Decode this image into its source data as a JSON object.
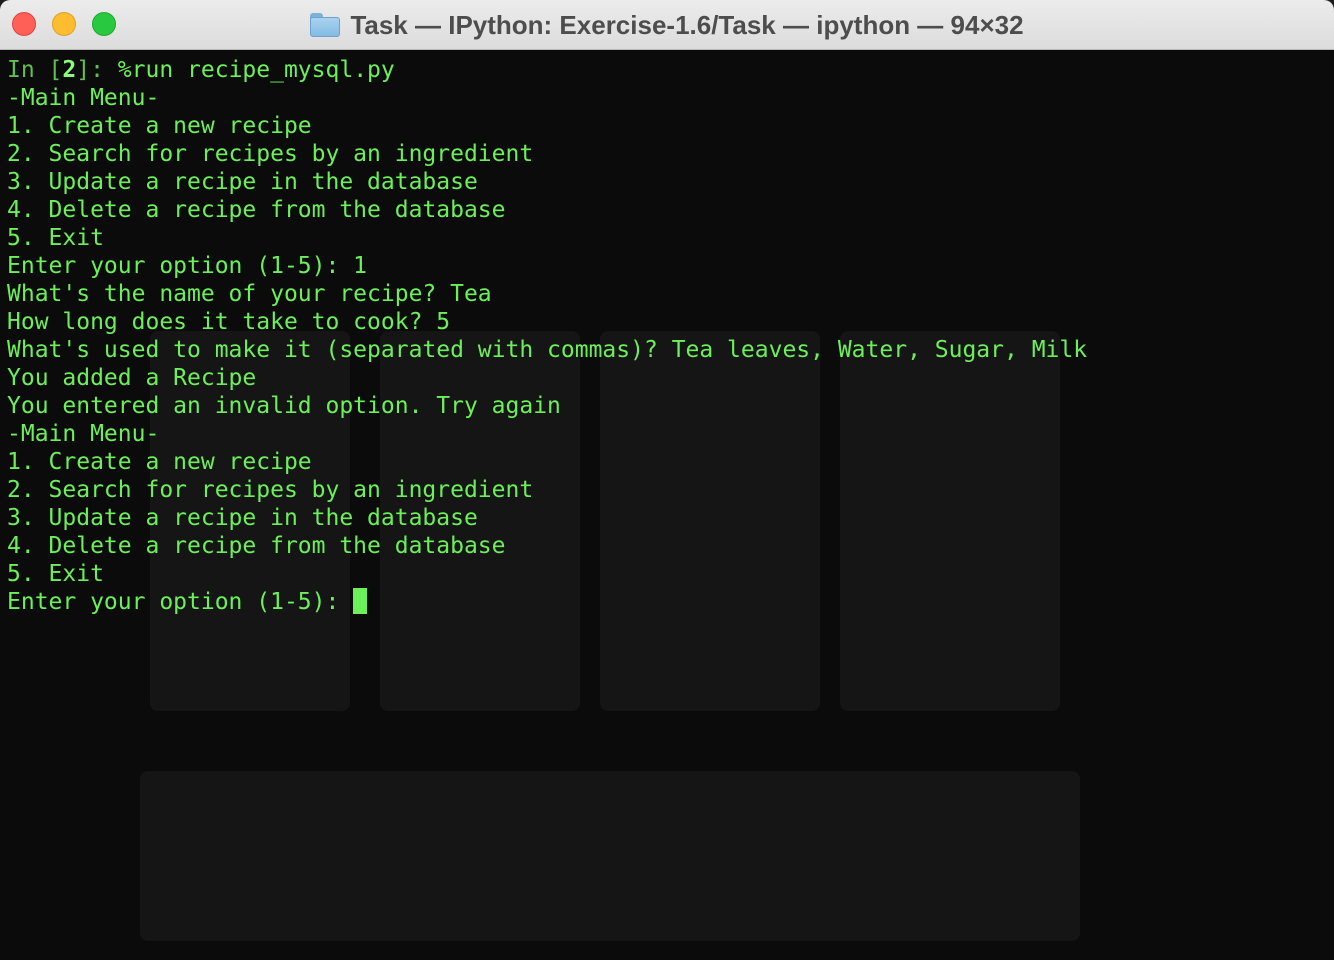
{
  "window": {
    "title": "Task — IPython: Exercise-1.6/Task — ipython — 94×32",
    "folder_icon": "folder-icon",
    "traffic_lights": {
      "close": "#fe5f57",
      "minimize": "#febc2e",
      "maximize": "#28c840"
    }
  },
  "terminal": {
    "text_color": "#6cf05a",
    "background": "#0b0b0b",
    "prompt": {
      "prefix": "In [",
      "number": "2",
      "suffix": "]: ",
      "command": "%run recipe_mysql.py"
    },
    "lines": [
      "-Main Menu-",
      "1. Create a new recipe",
      "2. Search for recipes by an ingredient",
      "3. Update a recipe in the database",
      "4. Delete a recipe from the database",
      "5. Exit",
      "Enter your option (1-5): 1",
      "What's the name of your recipe? Tea",
      "How long does it take to cook? 5",
      "What's used to make it (separated with commas)? Tea leaves, Water, Sugar, Milk",
      "You added a Recipe",
      "You entered an invalid option. Try again",
      "-Main Menu-",
      "1. Create a new recipe",
      "2. Search for recipes by an ingredient",
      "3. Update a recipe in the database",
      "4. Delete a recipe from the database",
      "5. Exit"
    ],
    "current_input_prompt": "Enter your option (1-5): "
  }
}
